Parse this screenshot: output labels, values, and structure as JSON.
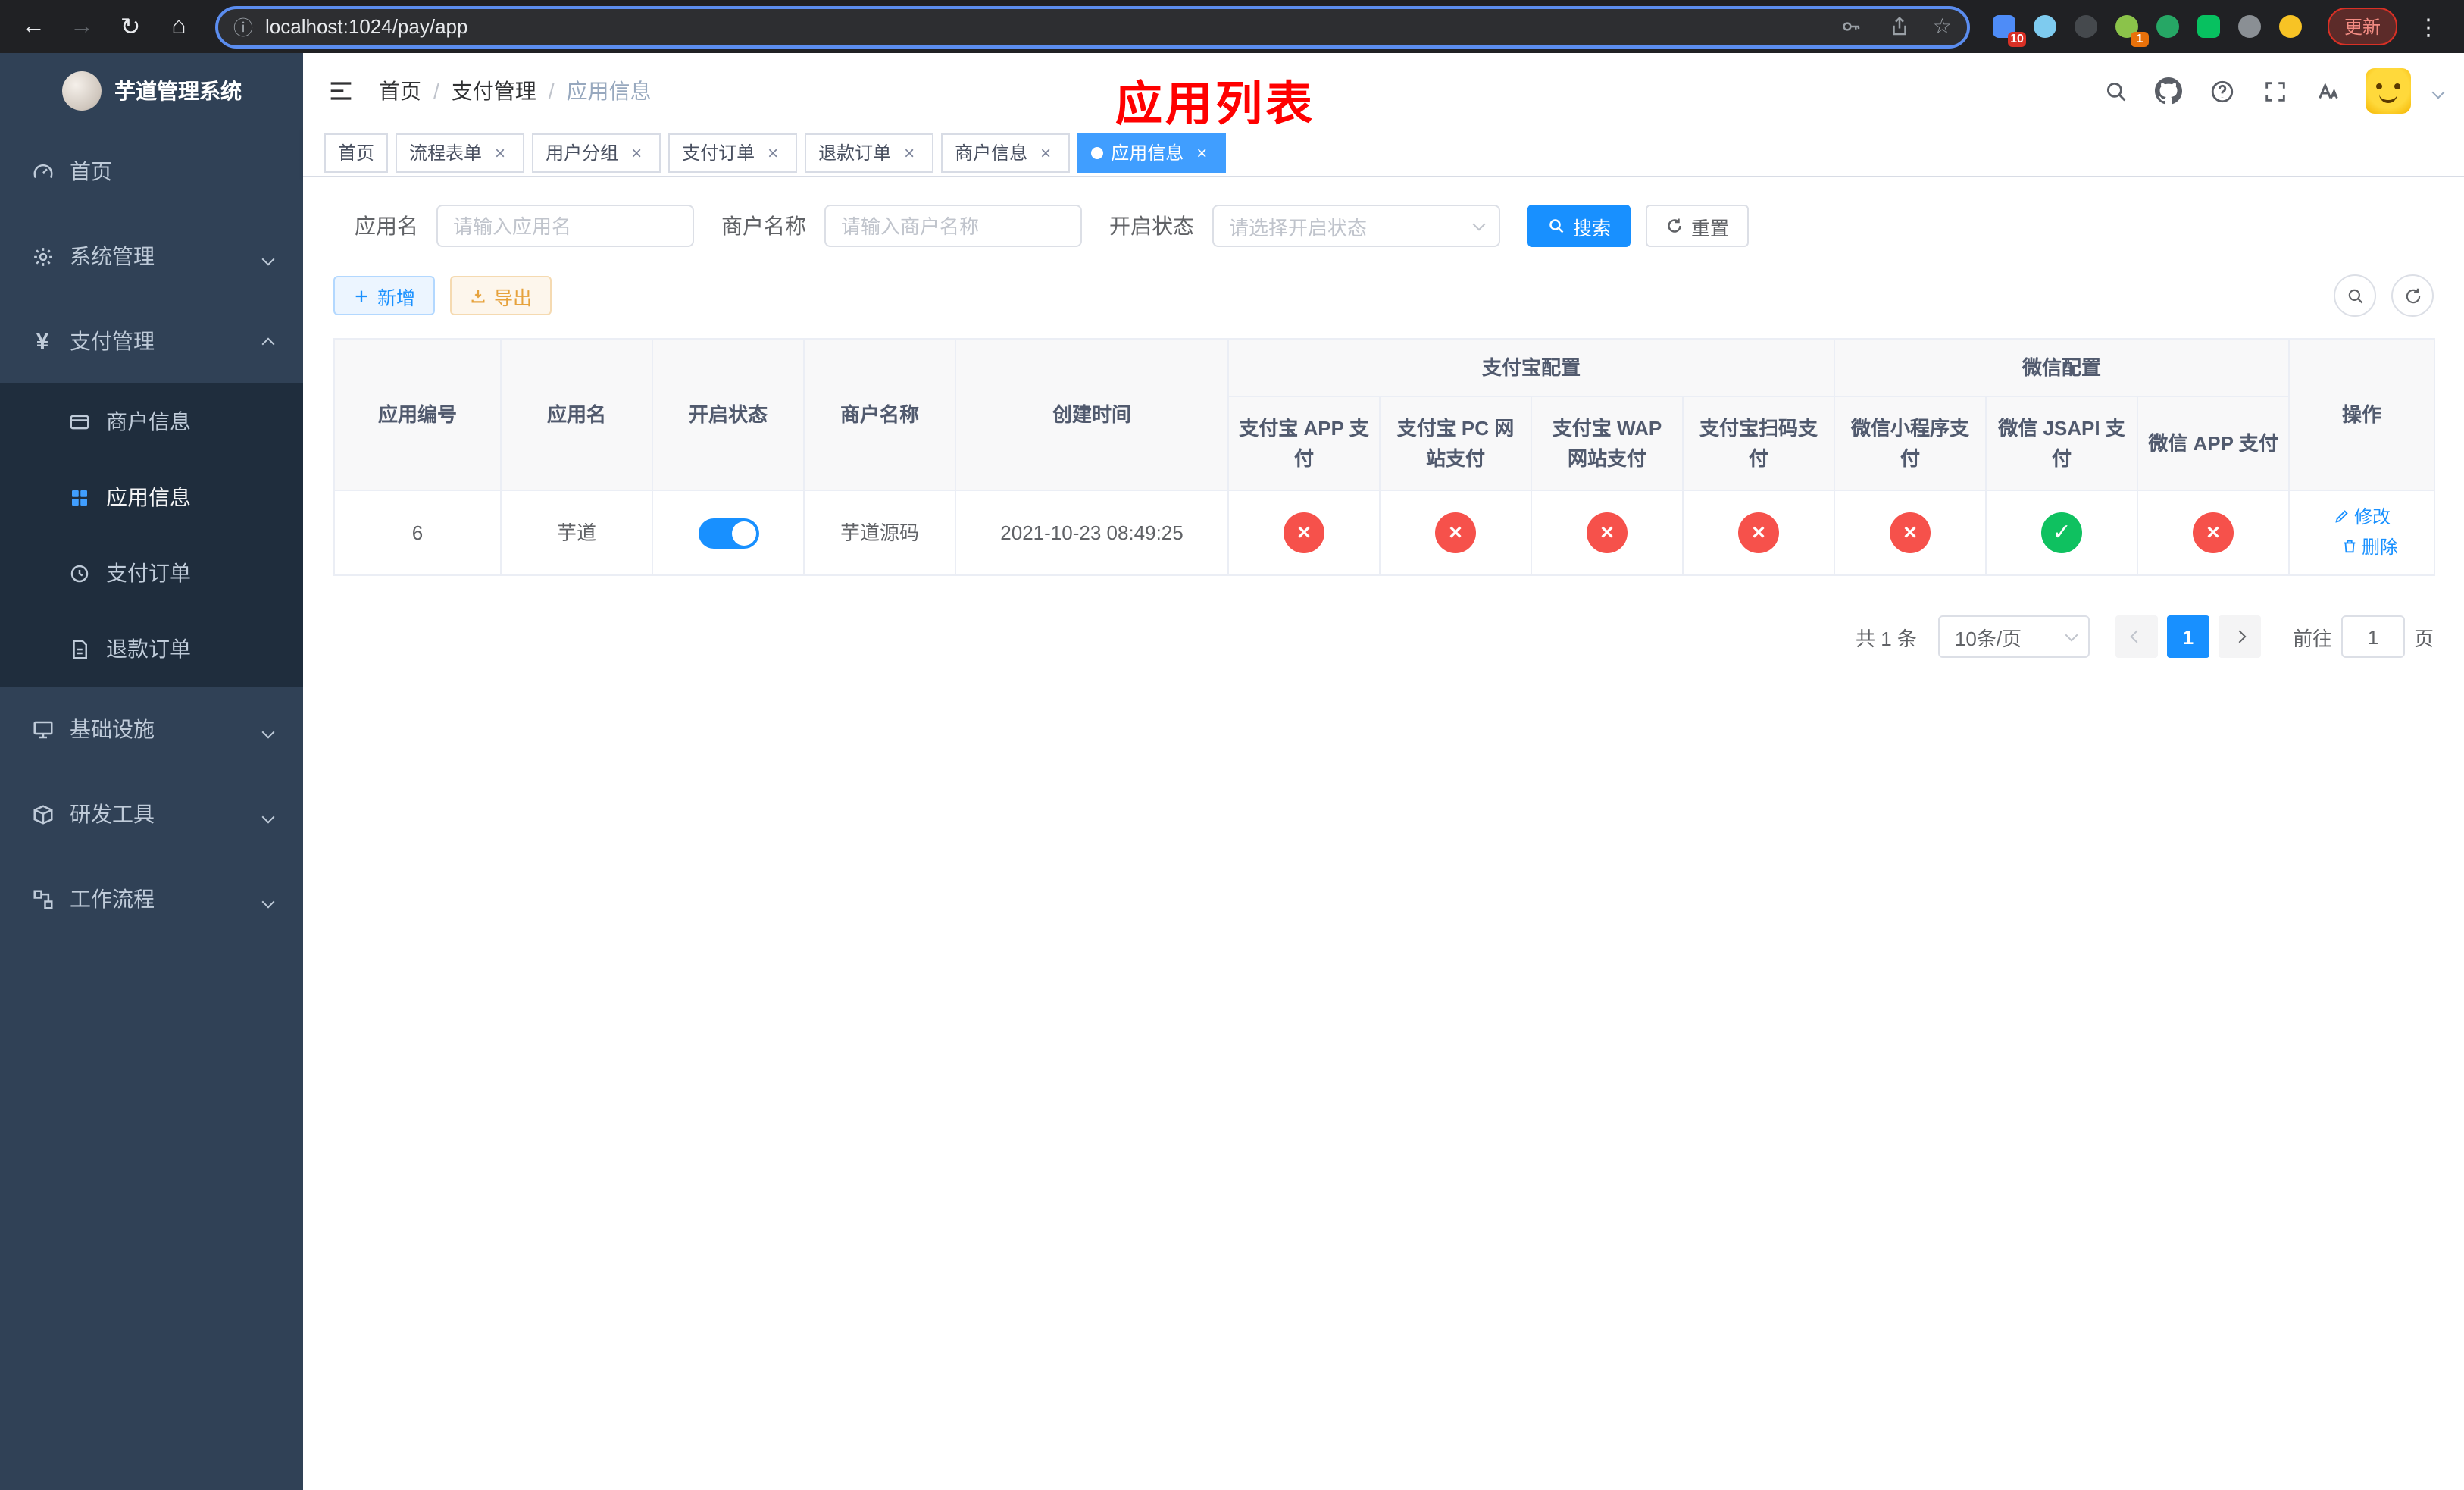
{
  "colors": {
    "primary": "#1890ff",
    "tab_active_bg": "#409eff",
    "success": "#0fc160",
    "danger": "#f6514b",
    "warning_text": "#e6a23c",
    "sidebar_bg": "#304156",
    "sidebar_submenu_bg": "#1f2d3d",
    "annotation_red": "#ff0000"
  },
  "icons": {
    "back": "←",
    "forward": "→",
    "reload": "↻",
    "home": "⌂",
    "info": "ⓘ",
    "star": "☆",
    "menu_dots": "⋮",
    "close": "×",
    "check": "✓",
    "cross": "×",
    "yen": "¥"
  },
  "browser": {
    "url": "localhost:1024/pay/app",
    "update_label": "更新",
    "ext_badge_1": "10",
    "ext_badge_2": "1"
  },
  "sidebar": {
    "title": "芋道管理系统",
    "items": [
      {
        "label": "首页",
        "sub": false,
        "expandable": false,
        "active": false
      },
      {
        "label": "系统管理",
        "sub": false,
        "expandable": true,
        "expanded": false,
        "active": false
      },
      {
        "label": "支付管理",
        "sub": false,
        "expandable": true,
        "expanded": true,
        "active": false
      },
      {
        "label": "商户信息",
        "sub": true,
        "active": false
      },
      {
        "label": "应用信息",
        "sub": true,
        "active": true
      },
      {
        "label": "支付订单",
        "sub": true,
        "active": false
      },
      {
        "label": "退款订单",
        "sub": true,
        "active": false
      },
      {
        "label": "基础设施",
        "sub": false,
        "expandable": true,
        "expanded": false,
        "active": false
      },
      {
        "label": "研发工具",
        "sub": false,
        "expandable": true,
        "expanded": false,
        "active": false
      },
      {
        "label": "工作流程",
        "sub": false,
        "expandable": true,
        "expanded": false,
        "active": false
      }
    ]
  },
  "header": {
    "breadcrumb": [
      "首页",
      "支付管理",
      "应用信息"
    ],
    "separator": "/",
    "annotation": "应用列表"
  },
  "tabs": [
    {
      "label": "首页",
      "closable": false,
      "active": false
    },
    {
      "label": "流程表单",
      "closable": true,
      "active": false
    },
    {
      "label": "用户分组",
      "closable": true,
      "active": false
    },
    {
      "label": "支付订单",
      "closable": true,
      "active": false
    },
    {
      "label": "退款订单",
      "closable": true,
      "active": false
    },
    {
      "label": "商户信息",
      "closable": true,
      "active": false
    },
    {
      "label": "应用信息",
      "closable": true,
      "active": true
    }
  ],
  "filters": {
    "app_name_label": "应用名",
    "app_name_placeholder": "请输入应用名",
    "merchant_label": "商户名称",
    "merchant_placeholder": "请输入商户名称",
    "status_label": "开启状态",
    "status_placeholder": "请选择开启状态",
    "search_label": "搜索",
    "reset_label": "重置"
  },
  "toolbar": {
    "add_label": "新增",
    "export_label": "导出"
  },
  "table": {
    "group_alipay": "支付宝配置",
    "group_wechat": "微信配置",
    "col_id": "应用编号",
    "col_name": "应用名",
    "col_status": "开启状态",
    "col_merchant": "商户名称",
    "col_created": "创建时间",
    "col_alipay_app": "支付宝 APP 支付",
    "col_alipay_pc": "支付宝 PC 网站支付",
    "col_alipay_wap": "支付宝 WAP 网站支付",
    "col_alipay_qr": "支付宝扫码支付",
    "col_wx_mini": "微信小程序支付",
    "col_wx_jsapi": "微信 JSAPI 支付",
    "col_wx_app": "微信 APP 支付",
    "col_actions": "操作",
    "row": {
      "id": "6",
      "name": "芋道",
      "enabled": true,
      "merchant": "芋道源码",
      "created": "2021-10-23 08:49:25",
      "configs": [
        false,
        false,
        false,
        false,
        false,
        true,
        false
      ],
      "edit_label": "修改",
      "delete_label": "删除"
    }
  },
  "pagination": {
    "total": "共 1 条",
    "page_size": "10条/页",
    "page": "1",
    "goto_label": "前往",
    "goto_value": "1",
    "goto_unit": "页"
  }
}
